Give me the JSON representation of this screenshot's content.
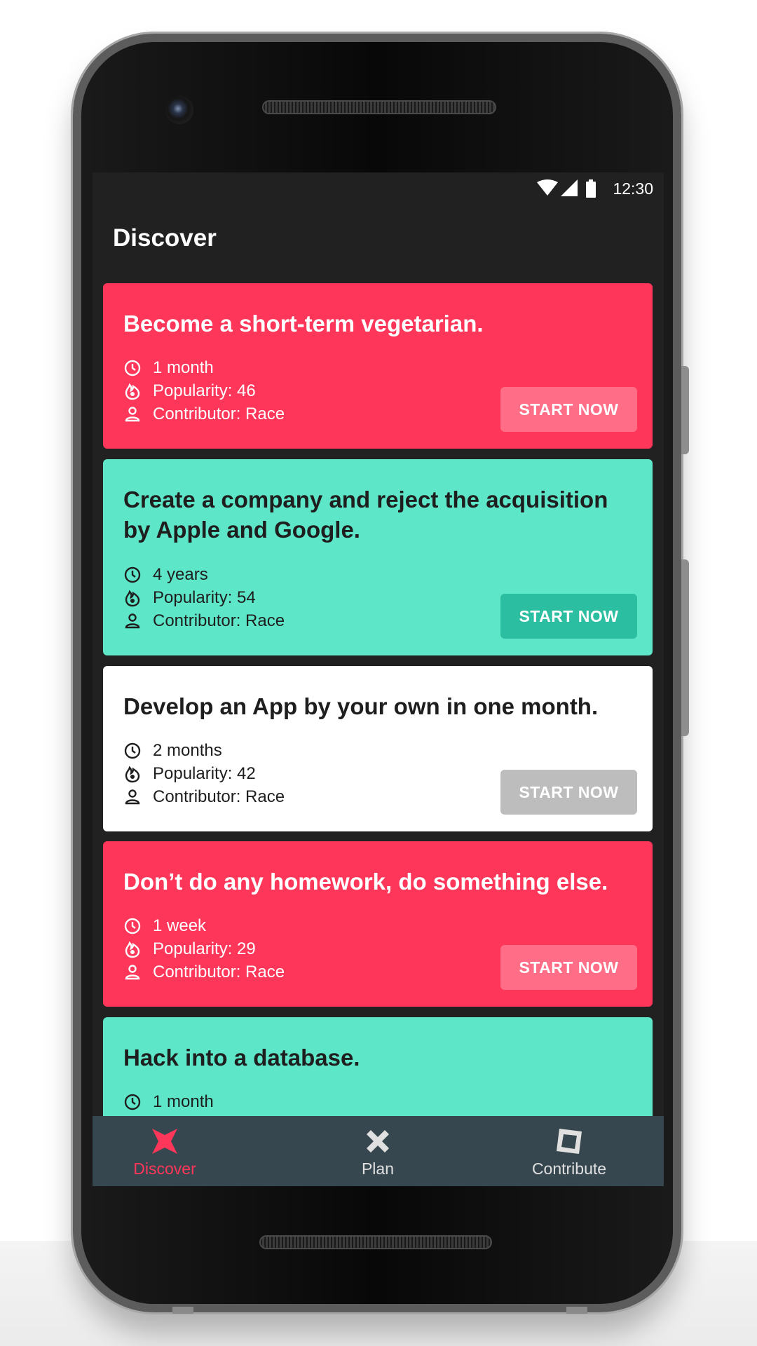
{
  "status_bar": {
    "time": "12:30"
  },
  "app_bar": {
    "title": "Discover"
  },
  "cards": [
    {
      "title": "Become a short-term vegetarian.",
      "duration": "1 month",
      "popularity": "Popularity: 46",
      "contributor": "Contributor: Race",
      "button": "START NOW",
      "color": "#fe3659"
    },
    {
      "title": "Create a company and reject the acquisition by Apple and Google.",
      "duration": "4 years",
      "popularity": "Popularity: 54",
      "contributor": "Contributor: Race",
      "button": "START NOW",
      "color": "#5ee6c8"
    },
    {
      "title": "Develop an App by your own in one month.",
      "duration": "2 months",
      "popularity": "Popularity: 42",
      "contributor": "Contributor: Race",
      "button": "START NOW",
      "color": "#ffffff"
    },
    {
      "title": "Don’t do any homework, do something else.",
      "duration": "1 week",
      "popularity": "Popularity: 29",
      "contributor": "Contributor: Race",
      "button": "START NOW",
      "color": "#fe3659"
    },
    {
      "title": "Hack into a database.",
      "duration": "1 month",
      "color": "#5ee6c8"
    }
  ],
  "bottom_nav": {
    "items": [
      {
        "label": "Discover",
        "icon": "discover-star-icon",
        "active": true
      },
      {
        "label": "Plan",
        "icon": "plan-cross-icon",
        "active": false
      },
      {
        "label": "Contribute",
        "icon": "contribute-square-icon",
        "active": false
      }
    ]
  },
  "colors": {
    "active": "#fe3659",
    "inactive": "#e0e0e0",
    "nav_background": "#36474f",
    "screen_background": "#212121"
  }
}
